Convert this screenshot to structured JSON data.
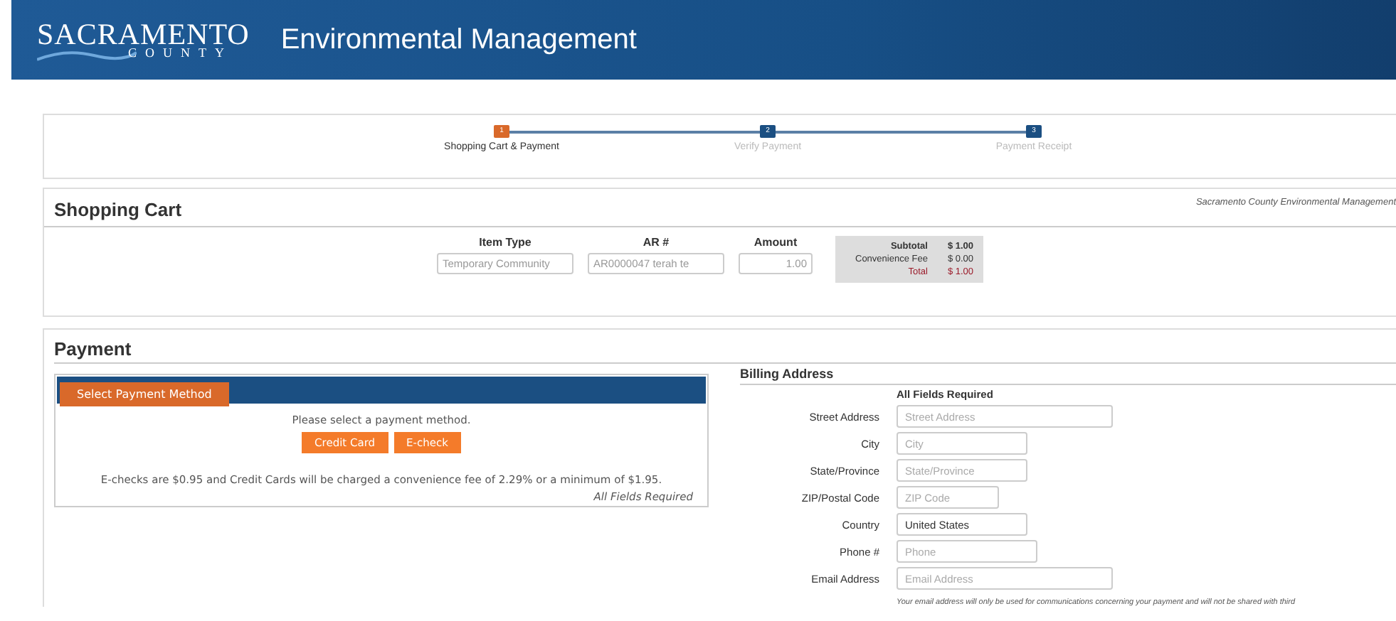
{
  "header": {
    "logo_top": "SACRAMENTO",
    "logo_bottom": "COUNTY",
    "title": "Environmental Management"
  },
  "steps": [
    {
      "number": "1",
      "label": "Shopping Cart & Payment",
      "selected": true
    },
    {
      "number": "2",
      "label": "Verify Payment",
      "selected": false
    },
    {
      "number": "3",
      "label": "Payment Receipt",
      "selected": false
    }
  ],
  "shopping_cart": {
    "title": "Shopping Cart",
    "agency": "Sacramento County Environmental Management",
    "columns": [
      {
        "label": "Item Type",
        "value": "Temporary Community"
      },
      {
        "label": "AR #",
        "value": "AR0000047 terah te"
      },
      {
        "label": "Amount",
        "value": "1.00"
      }
    ],
    "summary": [
      {
        "label": "Subtotal",
        "value": "$ 1.00",
        "kind": "normal"
      },
      {
        "label": "Convenience Fee",
        "value": "$ 0.00",
        "kind": "normal"
      },
      {
        "label": "Total",
        "value": "$ 1.00",
        "kind": "total"
      }
    ]
  },
  "payment": {
    "title": "Payment",
    "tab": {
      "label": "Select Payment Method",
      "selected": true
    },
    "prompt": "Please select a payment method.",
    "buttons": [
      "Credit Card",
      "E-check"
    ],
    "note": "E-checks are $0.95 and Credit Cards will be charged a convenience fee of 2.29% or a minimum of $1.95.",
    "required": "All Fields Required"
  },
  "billing": {
    "title": "Billing Address",
    "required": "All Fields Required",
    "fields": [
      {
        "label": "Street Address",
        "placeholder": "Street Address"
      },
      {
        "label": "City",
        "placeholder": "City"
      },
      {
        "label": "State/Province",
        "placeholder": "State/Province"
      },
      {
        "label": "ZIP/Postal Code",
        "placeholder": "ZIP Code"
      },
      {
        "label": "Country",
        "value": "United States"
      },
      {
        "label": "Phone #",
        "placeholder": "Phone"
      },
      {
        "label": "Email Address",
        "placeholder": "Email Address"
      }
    ],
    "email_note": "Your email address will only be used for communications concerning your payment and will not be shared with third"
  }
}
